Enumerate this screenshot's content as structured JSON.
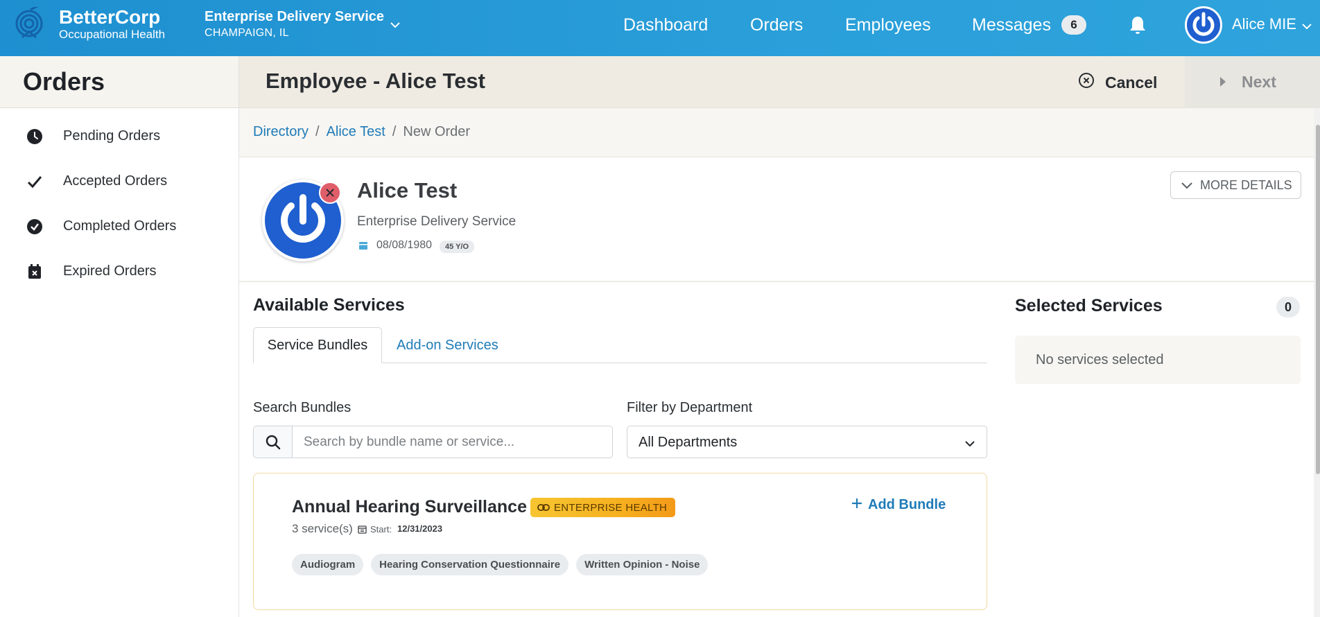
{
  "brand": {
    "name": "BetterCorp",
    "subtitle": "Occupational Health"
  },
  "org": {
    "name": "Enterprise Delivery Service",
    "location": "CHAMPAIGN, IL"
  },
  "nav": {
    "dashboard": "Dashboard",
    "orders": "Orders",
    "employees": "Employees",
    "messages": "Messages",
    "messages_count": "6"
  },
  "user": {
    "name": "Alice MIE"
  },
  "sidebar": {
    "title": "Orders",
    "items": [
      {
        "label": "Pending Orders",
        "icon": "clock-icon"
      },
      {
        "label": "Accepted Orders",
        "icon": "check-icon"
      },
      {
        "label": "Completed Orders",
        "icon": "check-circle-icon"
      },
      {
        "label": "Expired Orders",
        "icon": "calendar-x-icon"
      }
    ]
  },
  "header": {
    "title": "Employee - Alice Test",
    "cancel_label": "Cancel",
    "next_label": "Next"
  },
  "breadcrumb": {
    "items": [
      "Directory",
      "Alice Test",
      "New Order"
    ],
    "separator": "/"
  },
  "employee": {
    "name": "Alice Test",
    "org": "Enterprise Delivery Service",
    "dob": "08/08/1980",
    "age": "45 Y/O",
    "more_details_label": "MORE DETAILS"
  },
  "available": {
    "title": "Available Services",
    "tabs": [
      "Service Bundles",
      "Add-on Services"
    ],
    "search_label": "Search Bundles",
    "search_placeholder": "Search by bundle name or service...",
    "filter_label": "Filter by Department",
    "filter_value": "All Departments"
  },
  "bundles": [
    {
      "name": "Annual Hearing Surveillance",
      "badge": "ENTERPRISE HEALTH",
      "count": "3 service(s)",
      "start_label": "Start:",
      "start": "12/31/2023",
      "add_label": "Add Bundle",
      "services": [
        "Audiogram",
        "Hearing Conservation Questionnaire",
        "Written Opinion - Noise"
      ]
    }
  ],
  "selected": {
    "title": "Selected Services",
    "count": "0",
    "empty_text": "No services selected"
  },
  "colors": {
    "topbar": "#2a9fd9",
    "link": "#1f7bb8",
    "avatar": "#1f5fcf",
    "badge_gold": "#f6b11f"
  }
}
